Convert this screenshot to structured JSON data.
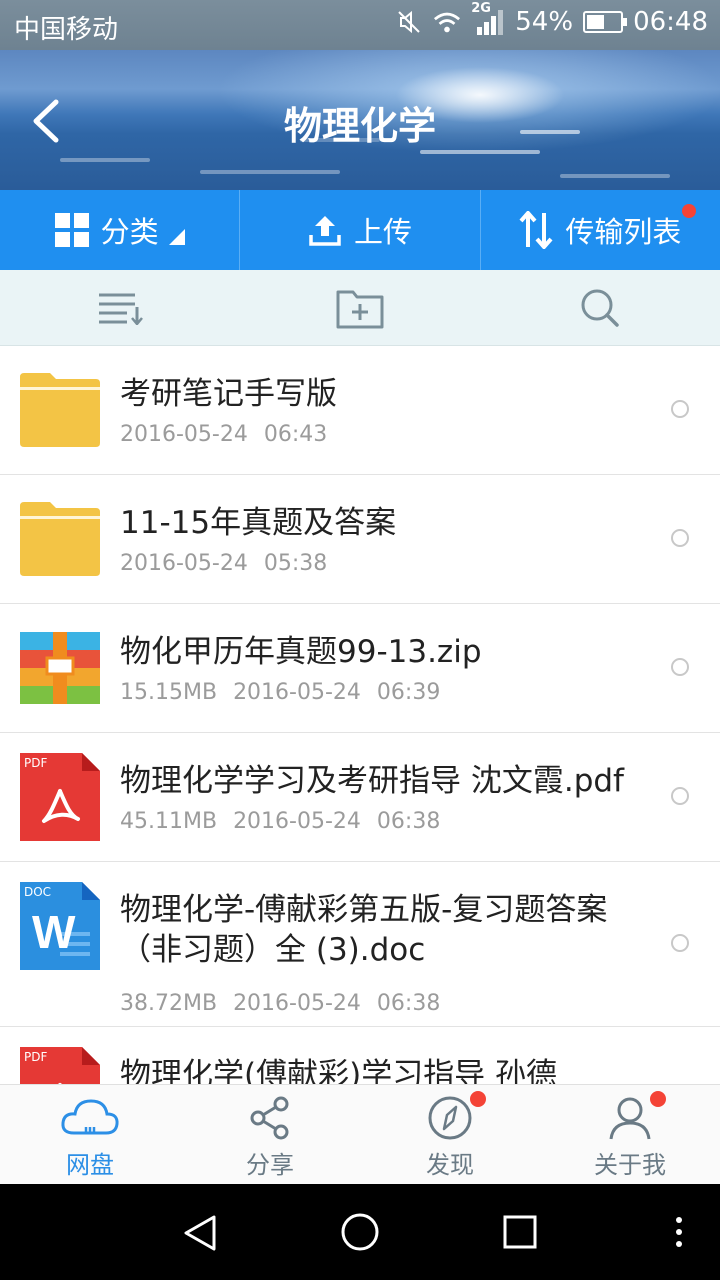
{
  "status_bar": {
    "carrier": "中国移动",
    "network": "2G",
    "battery": "54%",
    "battery_level": 0.54,
    "time": "06:48"
  },
  "header": {
    "title": "物理化学"
  },
  "actions": [
    {
      "label": "分类",
      "icon": "grid-icon"
    },
    {
      "label": "上传",
      "icon": "upload-icon"
    },
    {
      "label": "传输列表",
      "icon": "transfer-icon",
      "badge": true
    }
  ],
  "toolbar": [
    {
      "icon": "sort-icon"
    },
    {
      "icon": "new-folder-icon"
    },
    {
      "icon": "search-icon"
    }
  ],
  "files": [
    {
      "type": "folder",
      "name": "考研笔记手写版",
      "size": "",
      "date": "2016-05-24",
      "time": "06:43"
    },
    {
      "type": "folder",
      "name": "11-15年真题及答案",
      "size": "",
      "date": "2016-05-24",
      "time": "05:38"
    },
    {
      "type": "zip",
      "name": "物化甲历年真题99-13.zip",
      "size": "15.15MB",
      "date": "2016-05-24",
      "time": "06:39"
    },
    {
      "type": "pdf",
      "type_label": "PDF",
      "name": "物理化学学习及考研指导 沈文霞.pdf",
      "size": "45.11MB",
      "date": "2016-05-24",
      "time": "06:38"
    },
    {
      "type": "doc",
      "type_label": "DOC",
      "name": "物理化学-傅献彩第五版-复习题答案（非习题）全 (3).doc",
      "size": "38.72MB",
      "date": "2016-05-24",
      "time": "06:38"
    },
    {
      "type": "pdf",
      "type_label": "PDF",
      "name": "物理化学(傅献彩)学习指导 孙德",
      "size": "",
      "date": "",
      "time": ""
    }
  ],
  "bottom_nav": [
    {
      "label": "网盘",
      "icon": "cloud-icon",
      "active": true
    },
    {
      "label": "分享",
      "icon": "share-icon"
    },
    {
      "label": "发现",
      "icon": "compass-icon",
      "badge": true
    },
    {
      "label": "关于我",
      "icon": "user-icon",
      "badge": true
    }
  ],
  "colors": {
    "accent": "#1f8ff0",
    "folder": "#f3c445",
    "badge": "#f44336",
    "active_tab": "#2c8fe6"
  }
}
